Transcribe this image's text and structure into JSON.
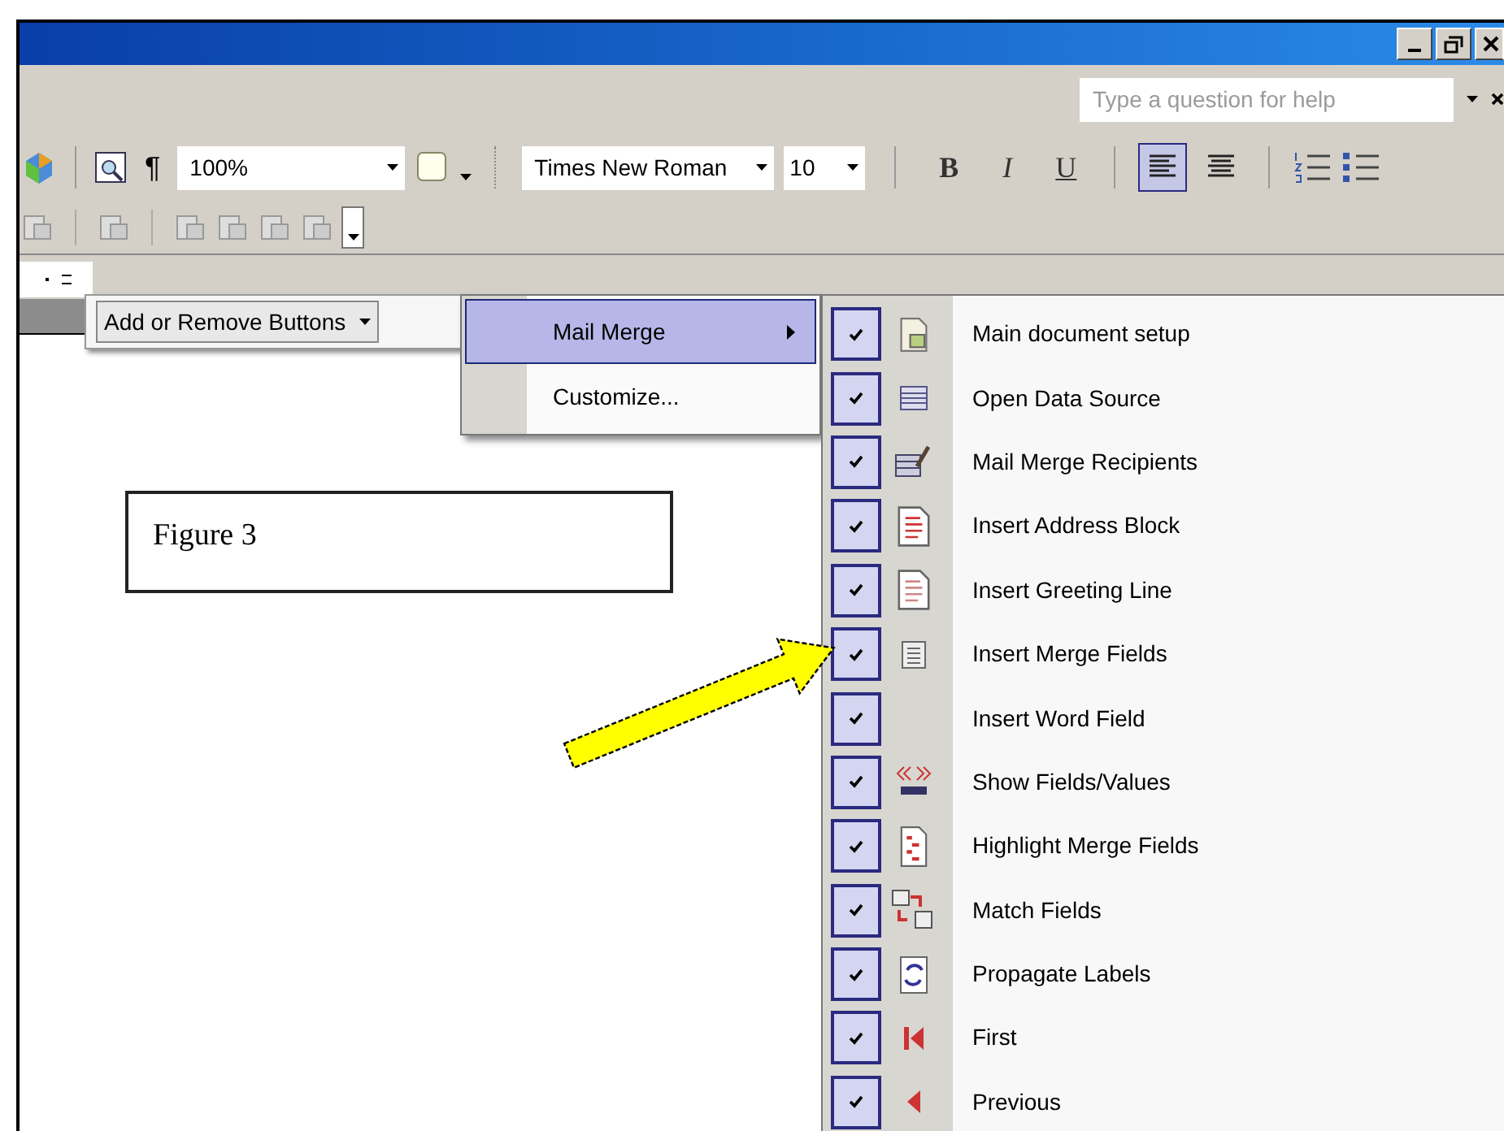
{
  "help": {
    "placeholder": "Type a question for help"
  },
  "formatting_toolbar": {
    "paragraph_mark": "¶",
    "zoom": "100%",
    "font": "Times New Roman",
    "size": "10",
    "format_buttons": [
      {
        "label": "B",
        "kind": "bold"
      },
      {
        "label": "I",
        "kind": "italic"
      },
      {
        "label": "U",
        "kind": "underline"
      }
    ],
    "align_buttons": [
      {
        "selected": true
      },
      {
        "selected": false
      }
    ]
  },
  "add_remove_menu": {
    "label": "Add or Remove Buttons"
  },
  "toolbar_menu": [
    {
      "label": "Mail Merge",
      "selected": true,
      "kind": "submenu"
    },
    {
      "label": "Customize...",
      "selected": false,
      "kind": "command"
    }
  ],
  "mail_merge_buttons": [
    {
      "label": "Main document setup",
      "checked": true
    },
    {
      "label": "Open Data Source",
      "checked": true
    },
    {
      "label": "Mail Merge Recipients",
      "checked": true
    },
    {
      "label": "Insert Address Block",
      "checked": true
    },
    {
      "label": "Insert Greeting Line",
      "checked": true
    },
    {
      "label": "Insert Merge Fields",
      "checked": true
    },
    {
      "label": "Insert Word Field",
      "checked": true
    },
    {
      "label": "Show Fields/Values",
      "checked": true
    },
    {
      "label": "Highlight Merge Fields",
      "checked": true
    },
    {
      "label": "Match Fields",
      "checked": true
    },
    {
      "label": "Propagate Labels",
      "checked": true
    },
    {
      "label": "First",
      "checked": true
    },
    {
      "label": "Previous",
      "checked": true
    }
  ],
  "document": {
    "text_box": "Figure 3"
  }
}
